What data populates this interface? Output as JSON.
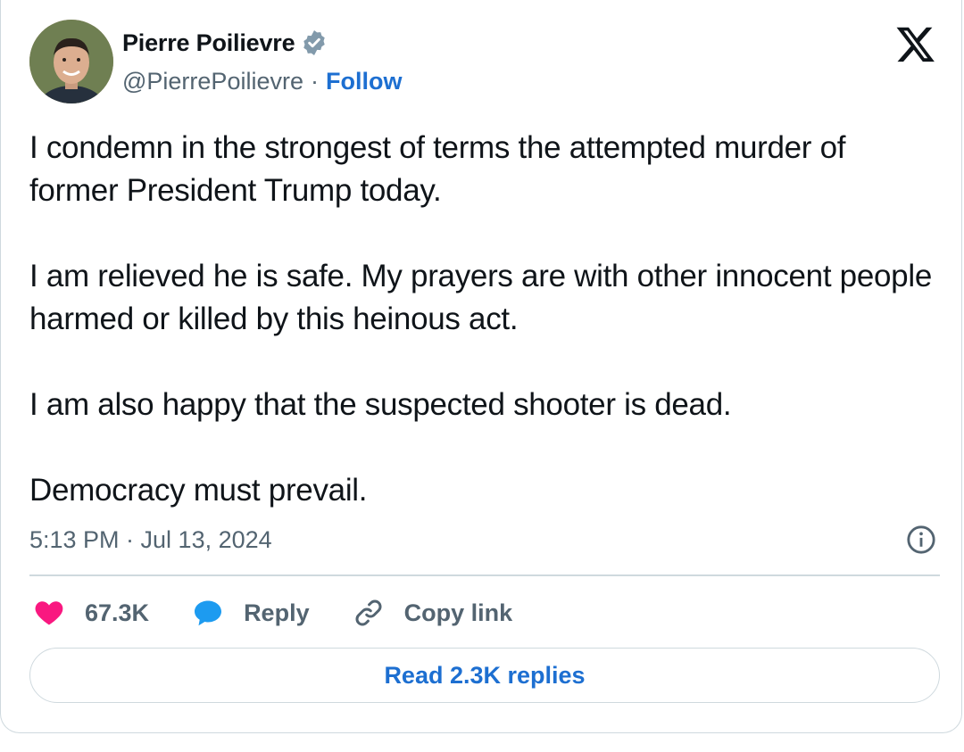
{
  "author": {
    "name": "Pierre Poilievre",
    "handle": "@PierrePoilievre",
    "separator": "·",
    "follow_label": "Follow",
    "verified_icon": "verified-badge-icon"
  },
  "brand": {
    "icon": "x-logo-icon"
  },
  "tweet": {
    "paragraphs": [
      "I condemn in the strongest of terms the attempted murder of former President Trump today.",
      "I am relieved he is safe. My prayers are with other innocent people harmed or killed by this heinous act.",
      "I am also happy that the suspected shooter is dead.",
      "Democracy must prevail."
    ],
    "timestamp": "5:13 PM · Jul 13, 2024"
  },
  "actions": {
    "like_count": "67.3K",
    "reply_label": "Reply",
    "copy_link_label": "Copy link"
  },
  "replies_button": {
    "label": "Read 2.3K replies"
  },
  "colors": {
    "link": "#1d6fd1",
    "muted": "#536471",
    "like": "#f91880",
    "reply": "#1d9bf0",
    "border": "#cfd9de"
  }
}
